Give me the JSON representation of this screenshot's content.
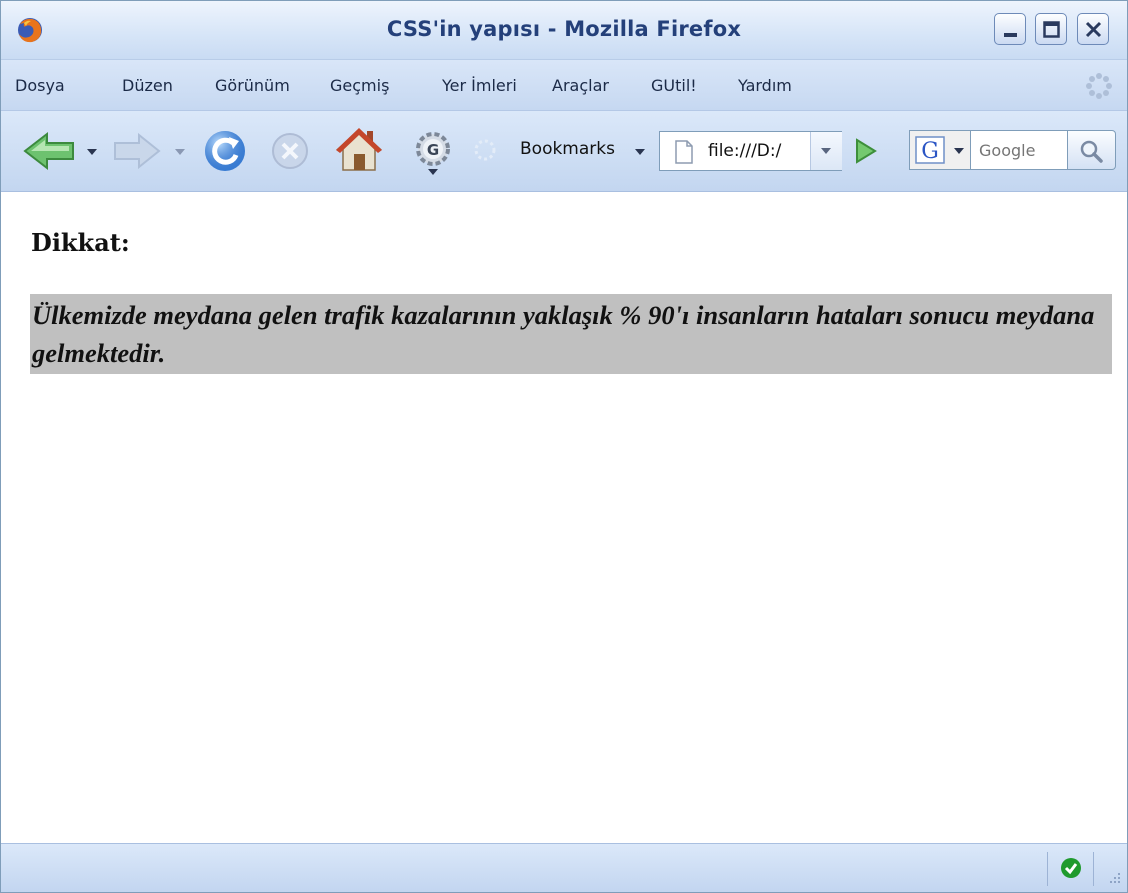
{
  "window": {
    "title": "CSS'in yapısı - Mozilla Firefox"
  },
  "menu": {
    "items": [
      "Dosya",
      "Düzen",
      "Görünüm",
      "Geçmiş",
      "Yer İmleri",
      "Araçlar",
      "GUtil!",
      "Yardım"
    ]
  },
  "toolbar": {
    "bookmarks_label": "Bookmarks",
    "url_value": "file:///D:/",
    "search_placeholder": "Google"
  },
  "page": {
    "heading": "Dikkat:",
    "highlight_text": "Ülkemizde meydana gelen trafik kazalarının yaklaşık % 90'ı insanların hataları sonucu meydana gelmektedir."
  },
  "colors": {
    "highlight_bg": "#c0c0c0",
    "titlebar_text": "#24407a"
  },
  "icons": {
    "back": "back-arrow-icon",
    "forward": "forward-arrow-icon",
    "reload": "reload-icon",
    "stop": "stop-icon",
    "home": "home-icon",
    "gutil": "gutil-gear-icon",
    "go": "go-arrow-icon",
    "search": "magnifier-icon",
    "status": "status-ok-icon"
  }
}
